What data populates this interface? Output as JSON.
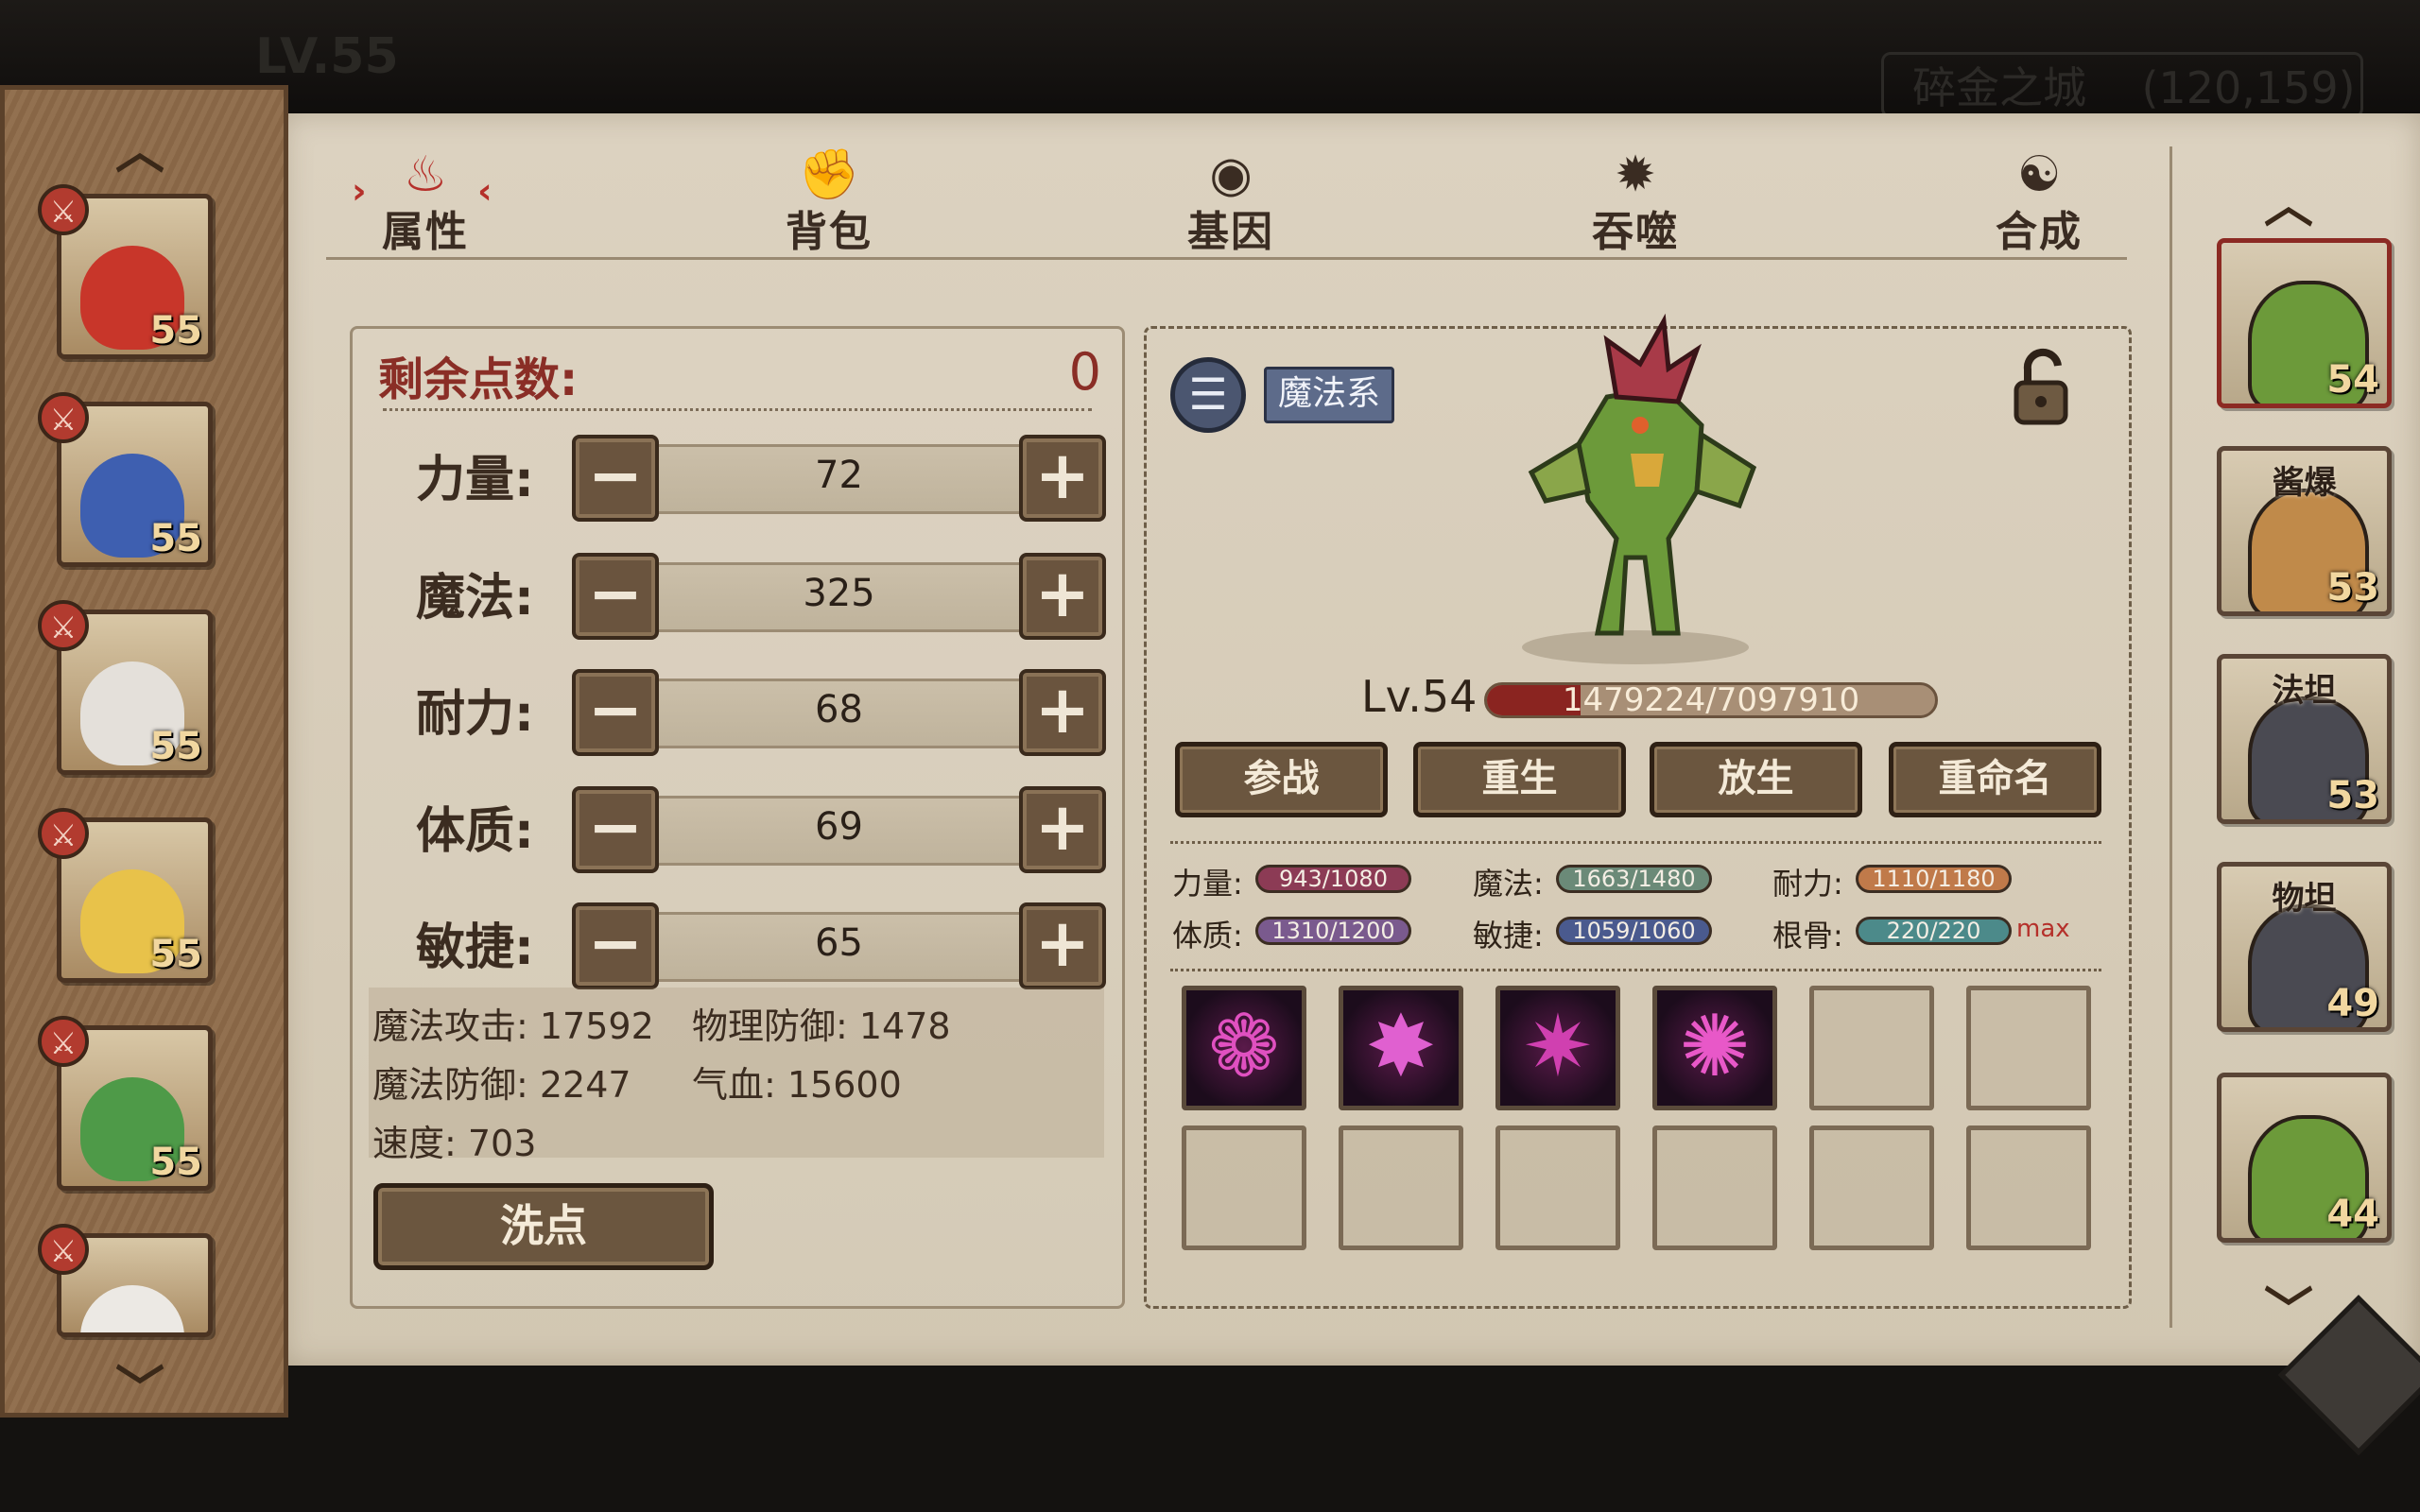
{
  "topbar": {
    "level": "LV.55",
    "location": "碎金之城    (120,159)"
  },
  "tabs": [
    {
      "label": "属性",
      "icon": "flame-icon",
      "active": true
    },
    {
      "label": "背包",
      "icon": "bag-icon",
      "active": false
    },
    {
      "label": "基因",
      "icon": "eye-icon",
      "active": false
    },
    {
      "label": "吞噬",
      "icon": "maw-icon",
      "active": false
    },
    {
      "label": "合成",
      "icon": "swirl-icon",
      "active": false
    }
  ],
  "team": [
    {
      "level": "55",
      "hair": "#c8362a"
    },
    {
      "level": "55",
      "hair": "#3e5fb0"
    },
    {
      "level": "55",
      "hair": "#e4e0da"
    },
    {
      "level": "55",
      "hair": "#e8c24a"
    },
    {
      "level": "55",
      "hair": "#4e9a48"
    },
    {
      "level": "",
      "hair": "#ece9e4"
    }
  ],
  "points": {
    "remaining_label": "剩余点数:",
    "remaining_value": "0",
    "stats": [
      {
        "label": "力量:",
        "value": "72"
      },
      {
        "label": "魔法:",
        "value": "325"
      },
      {
        "label": "耐力:",
        "value": "68"
      },
      {
        "label": "体质:",
        "value": "69"
      },
      {
        "label": "敏捷:",
        "value": "65"
      }
    ],
    "derived": [
      {
        "text": "魔法攻击: 17592"
      },
      {
        "text": "物理防御: 1478"
      },
      {
        "text": "魔法防御: 2247"
      },
      {
        "text": "气血: 15600"
      },
      {
        "text": "速度: 703"
      }
    ],
    "reset_label": "洗点"
  },
  "pet": {
    "type_tag": "魔法系",
    "level": "Lv.54",
    "exp_text": "1479224/7097910",
    "exp_fraction": 0.208,
    "actions": [
      "参战",
      "重生",
      "放生",
      "重命名"
    ],
    "aptitudes": [
      {
        "label": "力量:",
        "value": "943/1080",
        "color": "#8c3b55"
      },
      {
        "label": "魔法:",
        "value": "1663/1480",
        "color": "#6b8a78"
      },
      {
        "label": "耐力:",
        "value": "1110/1180",
        "color": "#c07a4a"
      },
      {
        "label": "体质:",
        "value": "1310/1200",
        "color": "#7a5a8e"
      },
      {
        "label": "敏捷:",
        "value": "1059/1060",
        "color": "#4a5a8e"
      },
      {
        "label": "根骨:",
        "value": "220/220",
        "color": "#4c8a8a"
      }
    ],
    "aptitude_max": "max",
    "skills_filled": 4,
    "skill_slots": 12
  },
  "pet_list": [
    {
      "name": "",
      "level": "54",
      "body": "#6c9a3a",
      "selected": true
    },
    {
      "name": "酱爆",
      "level": "53",
      "body": "#c08a4a",
      "selected": false
    },
    {
      "name": "法坦",
      "level": "53",
      "body": "#4a4a52",
      "selected": false
    },
    {
      "name": "物坦",
      "level": "49",
      "body": "#4a4a52",
      "selected": false
    },
    {
      "name": "",
      "level": "44",
      "body": "#6c9a3a",
      "selected": false
    }
  ]
}
